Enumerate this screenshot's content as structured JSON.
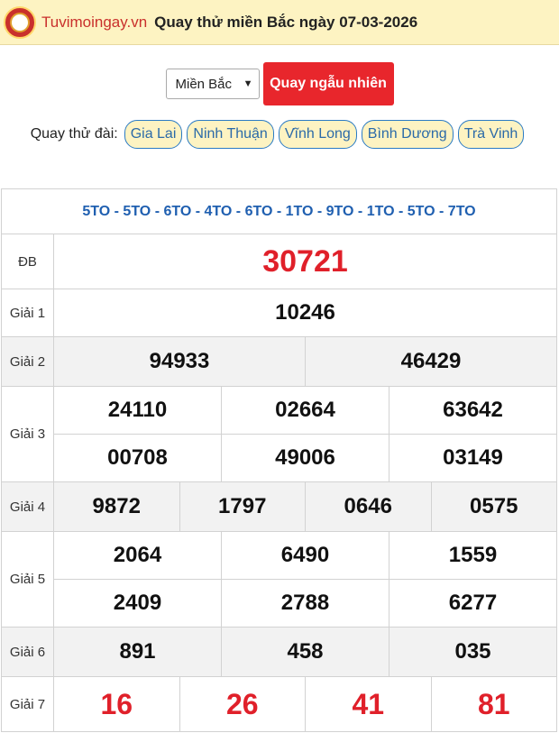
{
  "header": {
    "site_name": "Tuvimoingay.vn",
    "title": "Quay thử miền Bắc ngày 07-03-2026"
  },
  "controls": {
    "region_select": "Miền Bắc",
    "spin_button": "Quay ngẫu nhiên"
  },
  "stations": {
    "label": "Quay thử đài:",
    "items": [
      "Gia Lai",
      "Ninh Thuận",
      "Vĩnh Long",
      "Bình Dương",
      "Trà Vinh"
    ]
  },
  "results": {
    "codes": "5TO - 5TO - 6TO - 4TO - 6TO - 1TO - 9TO - 1TO - 5TO - 7TO",
    "labels": {
      "db": "ĐB",
      "g1": "Giải 1",
      "g2": "Giải 2",
      "g3": "Giải 3",
      "g4": "Giải 4",
      "g5": "Giải 5",
      "g6": "Giải 6",
      "g7": "Giải 7"
    },
    "db": "30721",
    "g1": "10246",
    "g2": [
      "94933",
      "46429"
    ],
    "g3": [
      "24110",
      "02664",
      "63642",
      "00708",
      "49006",
      "03149"
    ],
    "g4": [
      "9872",
      "1797",
      "0646",
      "0575"
    ],
    "g5": [
      "2064",
      "6490",
      "1559",
      "2409",
      "2788",
      "6277"
    ],
    "g6": [
      "891",
      "458",
      "035"
    ],
    "g7": [
      "16",
      "26",
      "41",
      "81"
    ]
  },
  "colors": {
    "brand_red": "#e8262c",
    "header_bg": "#fdf3c2",
    "link_blue": "#2b6aa8"
  }
}
